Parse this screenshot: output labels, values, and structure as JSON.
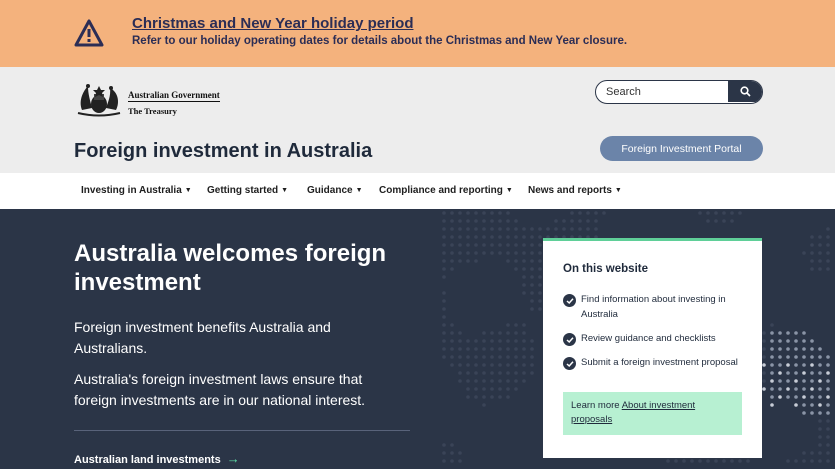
{
  "alert": {
    "title": "Christmas and New Year holiday period",
    "text": "Refer to our holiday operating dates for details about the Christmas and New Year closure.",
    "icon": "warning-icon"
  },
  "header": {
    "gov_name": "Australian Government",
    "dept": "The Treasury",
    "search_placeholder": "Search",
    "site_title": "Foreign investment in Australia",
    "portal_button": "Foreign Investment Portal"
  },
  "nav": {
    "items": [
      {
        "label": "Investing in Australia"
      },
      {
        "label": "Getting started"
      },
      {
        "label": "Guidance"
      },
      {
        "label": "Compliance and reporting"
      },
      {
        "label": "News and reports"
      }
    ]
  },
  "hero": {
    "title": "Australia welcomes foreign investment",
    "p1": "Foreign investment benefits Australia and Australians.",
    "p2": "Australia's foreign investment laws ensure that foreign investments are in our national interest.",
    "link": "Australian land investments"
  },
  "card": {
    "title": "On this website",
    "items": [
      {
        "label": "Find information about investing in Australia"
      },
      {
        "label": "Review guidance and checklists"
      },
      {
        "label": "Submit a foreign investment proposal"
      }
    ],
    "note_prefix": "Learn more ",
    "note_link": "About investment proposals"
  },
  "colors": {
    "alert_bg": "#f4b27d",
    "header_bg": "#ededed",
    "hero_bg": "#2b3547",
    "portal_button": "#6b84a9",
    "accent_green": "#5fcf98",
    "note_bg": "#b7f0d2"
  }
}
